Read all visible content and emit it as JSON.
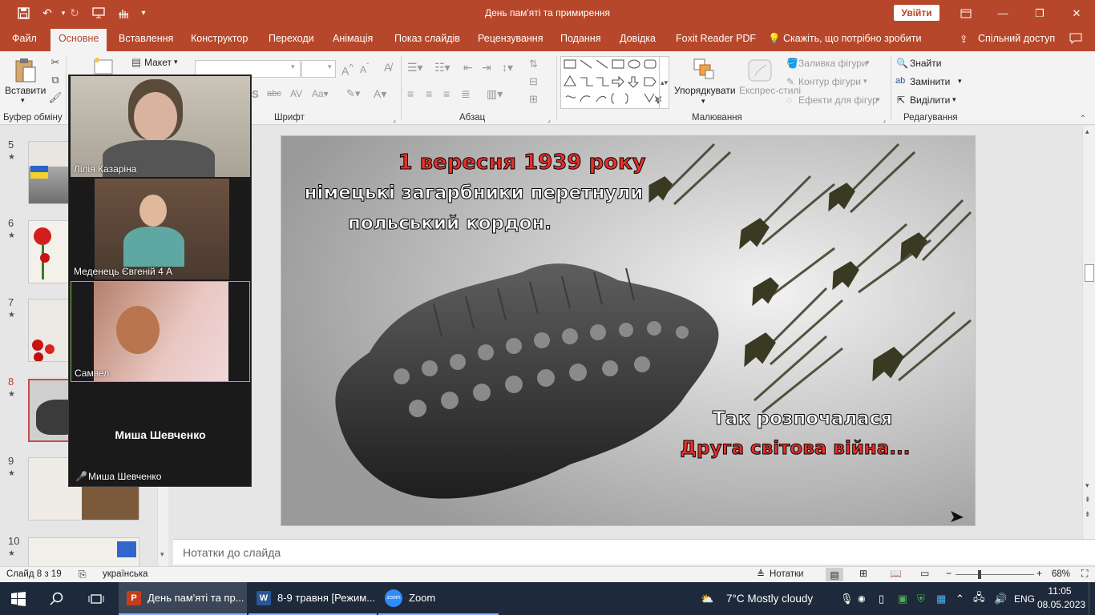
{
  "window": {
    "title": "День пам'яті та примирення",
    "signin_label": "Увійти",
    "controls": {
      "minimize": "—",
      "maximize": "❐",
      "close": "✕"
    }
  },
  "quick_access": {
    "save": "save-icon",
    "undo": "undo-icon",
    "redo": "redo-icon",
    "present": "present-icon",
    "touch": "touch-icon",
    "customize": "customize-icon"
  },
  "ribbon_tabs": [
    "Файл",
    "Основне",
    "Вставлення",
    "Конструктор",
    "Переходи",
    "Анімація",
    "Показ слайдів",
    "Рецензування",
    "Подання",
    "Довідка",
    "Foxit Reader PDF"
  ],
  "active_tab": "Основне",
  "tell_me": "Скажіть, що потрібно зробити",
  "share": "Спільний доступ",
  "ribbon": {
    "clipboard": {
      "paste": "Вставити",
      "group": "Буфер обміну"
    },
    "slides": {
      "layout": "Макет"
    },
    "font": {
      "group": "Шрифт",
      "font_name": "",
      "font_size": ""
    },
    "paragraph": {
      "group": "Абзац"
    },
    "drawing": {
      "arrange": "Упорядкувати",
      "quick_styles": "Експрес-стилі",
      "shape_fill": "Заливка фігури",
      "shape_outline": "Контур фігури",
      "shape_effects": "Ефекти для фігур",
      "group": "Малювання"
    },
    "editing": {
      "find": "Знайти",
      "replace": "Замінити",
      "select": "Виділити",
      "group": "Редагування"
    }
  },
  "thumbnails": [
    {
      "num": "5",
      "star": "★"
    },
    {
      "num": "6",
      "star": "★"
    },
    {
      "num": "7",
      "star": "★"
    },
    {
      "num": "8",
      "star": "★",
      "selected": true
    },
    {
      "num": "9",
      "star": "★"
    },
    {
      "num": "10",
      "star": "★"
    }
  ],
  "slide": {
    "line1_red": "1 вересня 1939 року",
    "line2": "німецькі загарбники перетнули",
    "line3": "польський кордон.",
    "line4": "Так розпочалася",
    "line5_red": "Друга світова війна...",
    "red_color": "#e8302a"
  },
  "notes_placeholder": "Нотатки до слайда",
  "status": {
    "slide_counter": "Слайд 8 з 19",
    "language": "українська",
    "notes": "Нотатки",
    "zoom_level": "68%"
  },
  "zoom_participants": [
    {
      "name": "Лілія Казаріна"
    },
    {
      "name": "Меденець Євгеній 4 А"
    },
    {
      "name": "Самвел"
    },
    {
      "name": "Миша Шевченко",
      "center_label": "Миша Шевченко",
      "muted": true
    }
  ],
  "taskbar": {
    "apps": [
      {
        "label": "День пам'яті та пр..."
      },
      {
        "label": "8-9 травня [Режим..."
      },
      {
        "label": "Zoom"
      }
    ],
    "weather": "7°C  Mostly cloudy",
    "lang": "ENG",
    "time": "11:05",
    "date": "08.05.2023"
  }
}
